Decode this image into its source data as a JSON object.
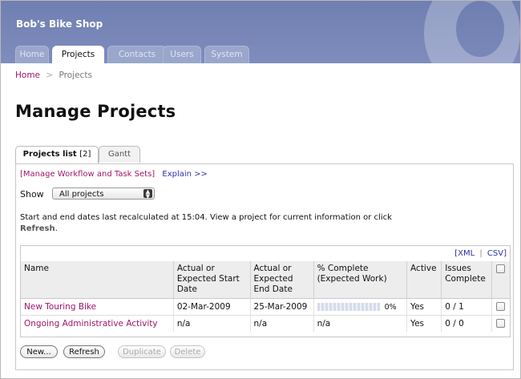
{
  "app": {
    "title": "Bob's Bike Shop"
  },
  "nav": {
    "tabs": [
      {
        "label": "Home"
      },
      {
        "label": "Projects"
      },
      {
        "label": "Contacts"
      },
      {
        "label": "Users"
      },
      {
        "label": "System"
      }
    ],
    "active": "Projects"
  },
  "breadcrumb": {
    "home": "Home",
    "separator": ">",
    "current": "Projects"
  },
  "page": {
    "title": "Manage Projects"
  },
  "subtabs": [
    {
      "label": "Projects list",
      "count": "[2]"
    },
    {
      "label": "Gantt"
    }
  ],
  "links": {
    "workflow": "[Manage Workflow and Task Sets]",
    "explain": "Explain >>"
  },
  "filter": {
    "label": "Show",
    "selected": "All projects"
  },
  "info": {
    "text": "Start and end dates last recalculated at 15:04. View a project for current information or click",
    "refresh_link": "Refresh",
    "trailing": "."
  },
  "export": {
    "xml": "[XML",
    "sep": "|",
    "csv": "CSV]"
  },
  "table": {
    "headers": {
      "name": "Name",
      "start": "Actual or Expected Start Date",
      "end": "Actual or Expected End Date",
      "complete": "% Complete (Expected Work)",
      "active": "Active",
      "issues": "Issues Complete"
    },
    "rows": [
      {
        "name": "New Touring Bike",
        "start": "02-Mar-2009",
        "end": "25-Mar-2009",
        "complete": "0%",
        "progress": 0,
        "active": "Yes",
        "issues": "0 / 1"
      },
      {
        "name": "Ongoing Administrative Activity",
        "start": "n/a",
        "end": "n/a",
        "complete": "n/a",
        "active": "Yes",
        "issues": "0 / 0"
      }
    ]
  },
  "buttons": {
    "new": "New...",
    "refresh": "Refresh",
    "duplicate": "Duplicate",
    "delete": "Delete"
  },
  "colors": {
    "header_bg": "#7483b6",
    "link_magenta": "#a0156b",
    "link_blue": "#2c2fa8"
  }
}
